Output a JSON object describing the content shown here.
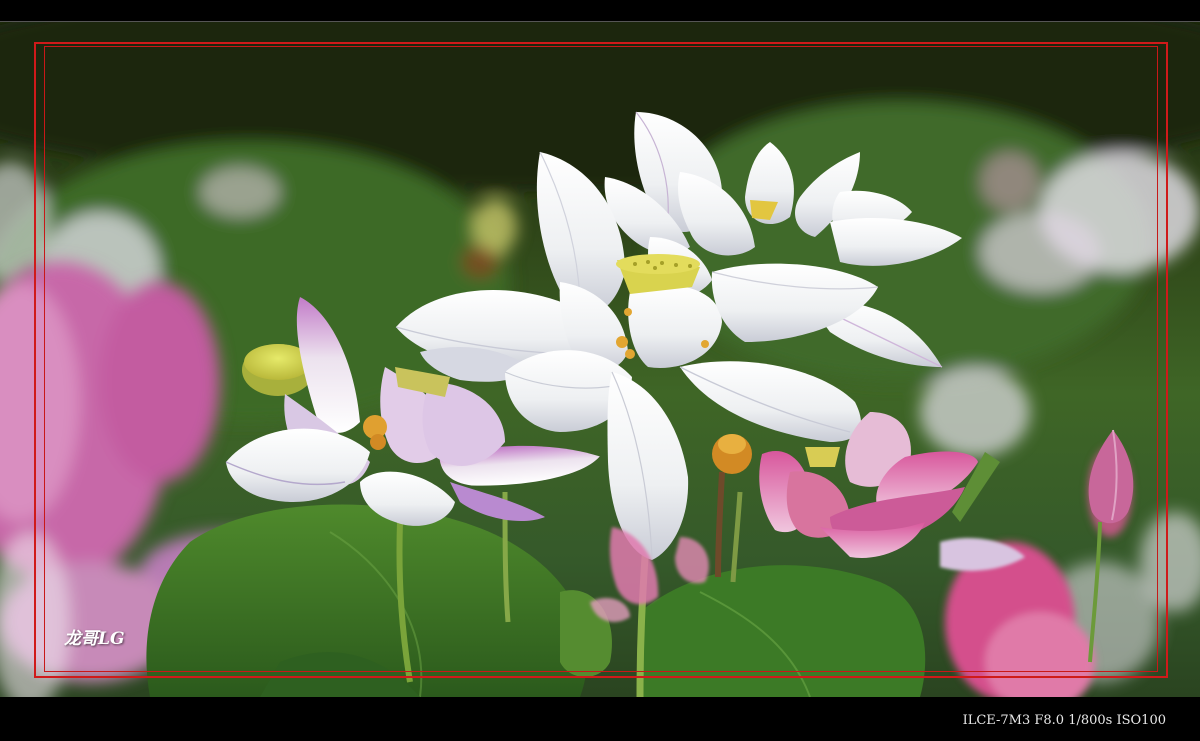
{
  "photo": {
    "subject": "lotus-flowers",
    "watermark_text": "龙哥LG",
    "exif_text": "ILCE-7M3 F8.0 1/800s ISO100"
  },
  "colors": {
    "frame_border": "#d01a1a",
    "background": "#000000",
    "exif_text": "#e8e8e8",
    "watermark_text": "#ffffff"
  }
}
